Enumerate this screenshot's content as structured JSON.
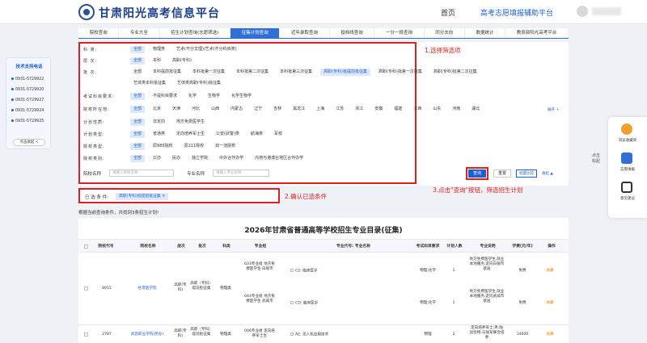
{
  "header": {
    "site_title": "甘肃阳光高考信息平台",
    "home": "首页",
    "assist": "高考志愿填报辅助平台"
  },
  "tabs": [
    "院校查询",
    "专业大全",
    "招生计划查询(志愿筛选)",
    "征集计划查询",
    "近年录取查询",
    "投档线查询",
    "一分一段查询",
    "同分去向",
    "数据统计",
    "教育部阳光高考平台"
  ],
  "active_tab": 3,
  "support": {
    "title": "技术支持电话",
    "phones": [
      "0931-5729922",
      "0931-5729920",
      "0931-5729927",
      "0931-5729924",
      "0931-5729925"
    ],
    "collapse": "点击收起 <"
  },
  "filters": {
    "subject": {
      "label": "科  类:",
      "options": [
        "全部",
        "物理类",
        "艺术(不分文理)/艺术(不分科目类)"
      ]
    },
    "level": {
      "label": "层  次:",
      "options": [
        "全部",
        "本科",
        "高职(专科)"
      ]
    },
    "batch": {
      "label": "批  次:",
      "options": [
        "全部",
        "本科提前批征集",
        "本科批第一次征集",
        "本科批第二次征集",
        "本科批第三次征集",
        "高职(专科)批提前批征集",
        "高职(专科)批第一次征集",
        "高职(专科)批第二次征集"
      ],
      "options2": [
        "艺体类本科批征集",
        "艺体类高职(专科)批征集"
      ]
    },
    "require": {
      "label": "考试科目要求:",
      "options": [
        "全部",
        "不提科目要求",
        "化学",
        "生物学",
        "化学生物学"
      ]
    },
    "location": {
      "label": "院校所在地:",
      "options": [
        "全部",
        "北京",
        "天津",
        "河北",
        "山西",
        "内蒙古",
        "辽宁",
        "吉林",
        "黑龙江",
        "上海",
        "江苏",
        "浙江",
        "安徽",
        "福建",
        "江西",
        "山东",
        "河南",
        "湖北"
      ],
      "more": "展开 +"
    },
    "nature": {
      "label": "计划性质:",
      "options": [
        "全部",
        "非定向",
        "地方免费医学生"
      ]
    },
    "plan_type": {
      "label": "计划类型:",
      "options": [
        "全部",
        "普通类",
        "定向培养军士生",
        "公安(武警)类",
        "航海类",
        "军校"
      ]
    },
    "school_type": {
      "label": "院校类型:",
      "options": [
        "全部",
        "原985院校",
        "原211院校",
        "双一流院校"
      ]
    },
    "school_kind": {
      "label": "院校类别:",
      "options": [
        "全部",
        "公办",
        "民办",
        "独立学院",
        "中外合作办学",
        "内地与港澳台地区合作办学"
      ]
    },
    "search": {
      "school_label": "院校名称",
      "school_placeholder": "请输入院校名称",
      "major_label": "专业名称",
      "major_placeholder": "请输入专业名称"
    }
  },
  "buttons": {
    "query": "查询",
    "reset": "重置",
    "compare": "批量比较",
    "fold": "收起 ▲"
  },
  "annotations": {
    "a1": "1.选择筛选项",
    "a2": "2.确认已选条件",
    "a3": "3.点击\"查询\"按钮，筛选招生计划"
  },
  "selected": {
    "label": "已 选 条 件:",
    "chip": "高职(专科)批提前批征集 ✕"
  },
  "result_note": "根据当前查询条件，共找到3条招生计划!",
  "table": {
    "title": "2026年甘肃省普通高等学校招生专业目录(征集)",
    "headers": [
      "院校代号",
      "院校名称",
      "层次",
      "批次",
      "科类",
      "专业组",
      "专业代号: 专业名称",
      "考试科目要求",
      "计划人数",
      "专业说明",
      "学费(元/年)",
      "操作"
    ],
    "rows": [
      {
        "code": "8015",
        "name": "甘肃医学院",
        "level": "高职(专科)",
        "batch": "高职（专科）提前批征集",
        "subject": "物理类",
        "groups": [
          {
            "group": "033专业组 地方免费医学生 白银市",
            "major": "C2: 临床医学",
            "req": "物理,化学",
            "count": "1",
            "desc": "地方免费医学生,就业本地服务,定向白银市基层",
            "fee": "免费",
            "op": "收藏"
          },
          {
            "group": "044专业组 地方免费医学生 武威市",
            "major": "CD: 临床医学",
            "req": "物理,化学",
            "count": "1",
            "desc": "地方免费医学生,就业本地服务,定向武威市基层",
            "fee": "免费",
            "op": "收藏"
          }
        ]
      },
      {
        "code": "2787",
        "name": "武昌职业学院(民办)",
        "level": "高职(专科)",
        "batch": "高职（专科）提前批征集",
        "subject": "物理类",
        "groups": [
          {
            "group": "006专业组 定向培养军士生",
            "major": "AE: 无人机应用技术",
            "req": "物理",
            "count": "2",
            "desc": "定向培养军士;男;陆战合格;与陆军联合培养",
            "fee": "14600",
            "op": "收藏"
          }
        ]
      }
    ]
  },
  "right_float": {
    "fav": "浏览收藏夹",
    "fill": "志愿填报",
    "feedback": "意见建议",
    "collapse": "点击收起"
  },
  "colors": {
    "primary": "#1d5fd0",
    "annotation": "#e02020"
  }
}
